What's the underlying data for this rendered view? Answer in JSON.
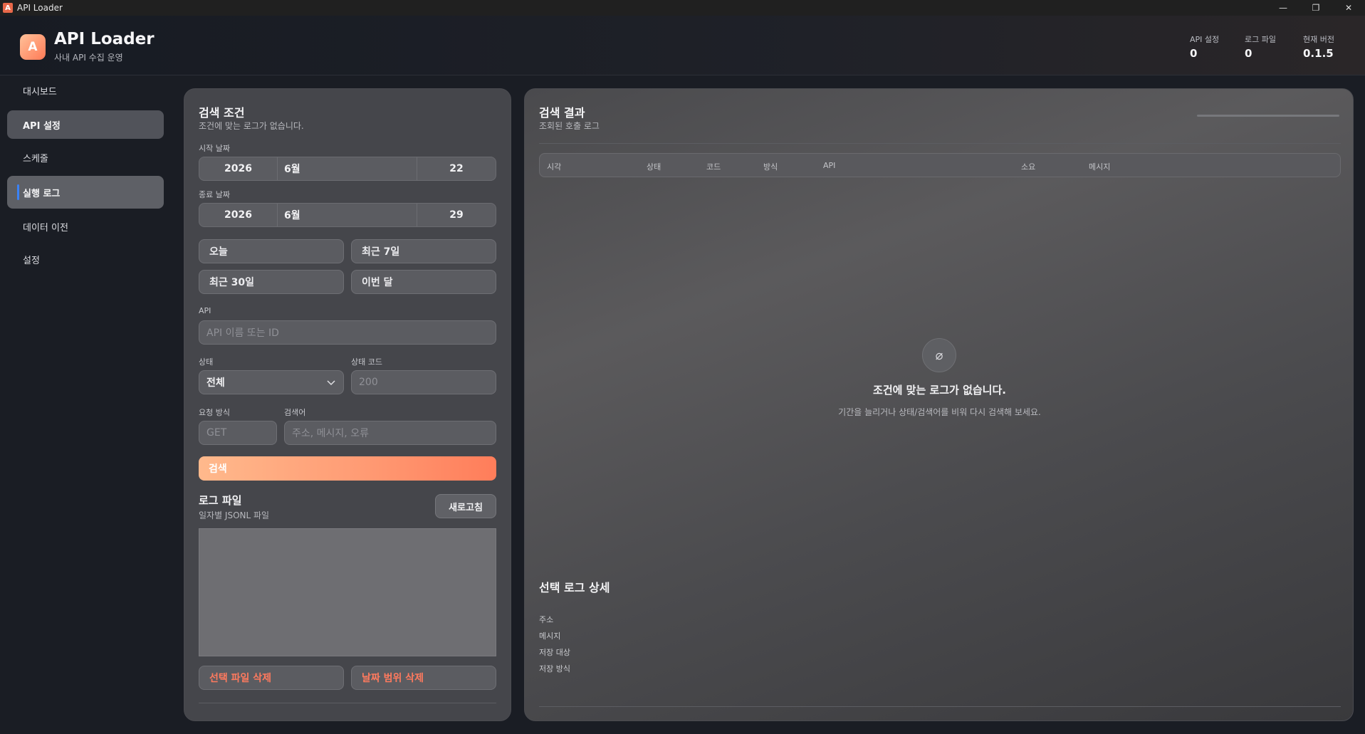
{
  "window": {
    "title": "API Loader",
    "icon_letter": "A",
    "controls": [
      "—",
      "❐",
      "✕"
    ]
  },
  "header": {
    "logo_letter": "A",
    "title": "API Loader",
    "subtitle": "사내 API 수집 운영",
    "stats": [
      {
        "label": "API 설정",
        "value": "0"
      },
      {
        "label": "로그 파일",
        "value": "0"
      },
      {
        "label": "현재 버전",
        "value": "0.1.5"
      }
    ]
  },
  "sidebar": {
    "items": [
      {
        "label": "대시보드"
      },
      {
        "label": "API 설정"
      },
      {
        "label": "스케줄"
      },
      {
        "label": "실행 로그"
      },
      {
        "label": "데이터 이전"
      },
      {
        "label": "설정"
      }
    ]
  },
  "search": {
    "title": "검색 조건",
    "subtitle": "조건에 맞는 로그가 없습니다.",
    "start_label": "시작 날짜",
    "start": {
      "year": "2026",
      "month": "6월",
      "day": "22"
    },
    "end_label": "종료 날짜",
    "end": {
      "year": "2026",
      "month": "6월",
      "day": "29"
    },
    "quick": [
      "오늘",
      "최근 7일",
      "최근 30일",
      "이번 달"
    ],
    "api_label": "API",
    "api_placeholder": "API 이름 또는 ID",
    "status_label": "상태",
    "status_value": "전체",
    "code_label": "상태 코드",
    "code_placeholder": "200",
    "method_label": "요청 방식",
    "method_placeholder": "GET",
    "keyword_label": "검색어",
    "keyword_placeholder": "주소, 메시지, 오류",
    "search_button": "검색"
  },
  "logfiles": {
    "title": "로그 파일",
    "subtitle": "일자별 JSONL 파일",
    "refresh": "새로고침",
    "delete_selected": "선택 파일 삭제",
    "delete_range": "날짜 범위 삭제"
  },
  "results": {
    "title": "검색 결과",
    "subtitle": "조회된 호출 로그",
    "columns": [
      "시각",
      "상태",
      "코드",
      "방식",
      "API",
      "소요",
      "메시지"
    ],
    "empty_icon": "⌀",
    "empty_title": "조건에 맞는 로그가 없습니다.",
    "empty_desc": "기간을 늘리거나 상태/검색어를 비워 다시 검색해 보세요.",
    "detail_title": "선택 로그 상세",
    "detail_fields": [
      "주소",
      "메시지",
      "저장 대상",
      "저장 방식"
    ]
  },
  "colors": {
    "accent": "#ff8a62",
    "danger": "#ff7a5e",
    "nav_indicator": "#3a82f7"
  }
}
